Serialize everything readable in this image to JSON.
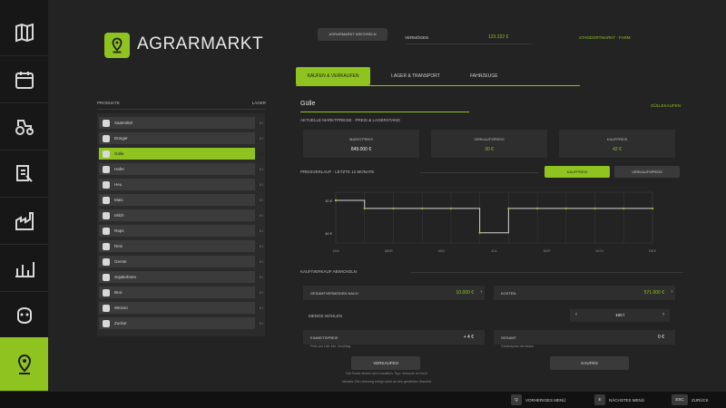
{
  "app": {
    "title": "AGRARMARKT",
    "logo_icon": "location-pin-icon",
    "accent_color": "#8fc31f"
  },
  "sidebar": {
    "items": [
      {
        "icon": "map-icon"
      },
      {
        "icon": "calendar-icon"
      },
      {
        "icon": "tractor-icon"
      },
      {
        "icon": "contracts-icon"
      },
      {
        "icon": "production-icon"
      },
      {
        "icon": "statistics-icon"
      },
      {
        "icon": "animals-icon"
      },
      {
        "icon": "marketplace-icon",
        "active": true
      }
    ]
  },
  "header": {
    "switch_button": "AGRARMARKT WECHSELN",
    "money_label": "VERMÖGEN",
    "money_value": "123.322 €",
    "market_status": "STANDORTMARKT · FARM"
  },
  "tabs": [
    {
      "label": "KAUFEN & VERKAUFEN",
      "active": true
    },
    {
      "label": "LAGER & TRANSPORT"
    },
    {
      "label": "FAHRZEUGE"
    }
  ],
  "product_list": {
    "col_product": "PRODUKTE",
    "col_stock": "LAGER",
    "items": [
      {
        "name": "Saatmittel",
        "qty": "0 l"
      },
      {
        "name": "Dünger",
        "qty": "0 l"
      },
      {
        "name": "Gülle",
        "qty": "0 l",
        "active": true
      },
      {
        "name": "Hafer",
        "qty": "0 l"
      },
      {
        "name": "Heu",
        "qty": "0 l"
      },
      {
        "name": "Mais",
        "qty": "0 l"
      },
      {
        "name": "Milch",
        "qty": "0 l"
      },
      {
        "name": "Raps",
        "qty": "0 l"
      },
      {
        "name": "Reis",
        "qty": "0 l"
      },
      {
        "name": "Gerste",
        "qty": "0 l"
      },
      {
        "name": "Sojabohnen",
        "qty": "0 l"
      },
      {
        "name": "Brot",
        "qty": "0 l"
      },
      {
        "name": "Weizen",
        "qty": "0 l"
      },
      {
        "name": "Zucker",
        "qty": "0 l"
      }
    ]
  },
  "detail": {
    "title": "Gülle",
    "link": "GÜLLEKAUFEN",
    "price_section": "AKTUELLE MARKTPREISE · PREIS & LAGERSTAND",
    "stats": [
      {
        "label": "MARKTPREIS",
        "value": "849.000 €"
      },
      {
        "label": "VERKAUFSPREIS",
        "value": "30 €",
        "green": true
      },
      {
        "label": "KAUFPREIS",
        "value": "42 €",
        "green": true
      }
    ],
    "chart_section": "PREISVERLAUF · LETZTE 12 MONATE",
    "chart_btn_on": "KAUFPREIS",
    "chart_btn_off": "VERKAUFSPREIS",
    "trade_section": "KAUF/VERKAUF ABWICKELN",
    "field_total_label": "GESAMTVERMÖGEN NACH",
    "field_total_value": "10.000 €",
    "field_cost_label": "KOSTEN",
    "field_cost_value": "571.000 €",
    "qty_label": "MENGE WÄHLEN",
    "qty_value": "100 l",
    "unit_label": "EINHEITSPREIS",
    "unit_value": "+ 4 €",
    "unit_sub": "Preis pro Liter inkl. Zuschlag",
    "total_label": "GESAMT",
    "total_value": "0 €",
    "total_sub": "Gesamtpreis der Aktion",
    "btn_sell": "VERKAUFEN",
    "btn_buy": "KAUFEN",
    "note_1": "Die Preise ändern sich monatlich. Tipp: Verkaufe im Hoch.",
    "note_2": "Hinweis: Die Lieferung erfolgt sofort an den gewählten Standort."
  },
  "chart_data": {
    "type": "line",
    "title": "",
    "xlabel": "",
    "ylabel": "",
    "x": [
      "JAN",
      "FEB",
      "MAR",
      "APR",
      "MAI",
      "JUN",
      "JUL",
      "AUG",
      "SEP",
      "OKT",
      "NOV",
      "DEZ"
    ],
    "x_ticks": [
      "JAN",
      "MÄR",
      "MAI",
      "JUL",
      "SEP",
      "NOV",
      "DEZ"
    ],
    "y_ticks": [
      "30 €",
      "46 €"
    ],
    "ylim": [
      25,
      50
    ],
    "series": [
      {
        "values": [
          46,
          42,
          42,
          42,
          42,
          30,
          42,
          42,
          42,
          42,
          42,
          42
        ]
      }
    ],
    "grid": true,
    "line_color": "#d4d4d4",
    "marker_color": "#8fc31f"
  },
  "footer": {
    "buttons": [
      {
        "key": "Q",
        "label": "VORHERIGES MENÜ"
      },
      {
        "key": "E",
        "label": "NÄCHSTES MENÜ"
      },
      {
        "key": "ESC",
        "label": "ZURÜCK"
      }
    ]
  }
}
